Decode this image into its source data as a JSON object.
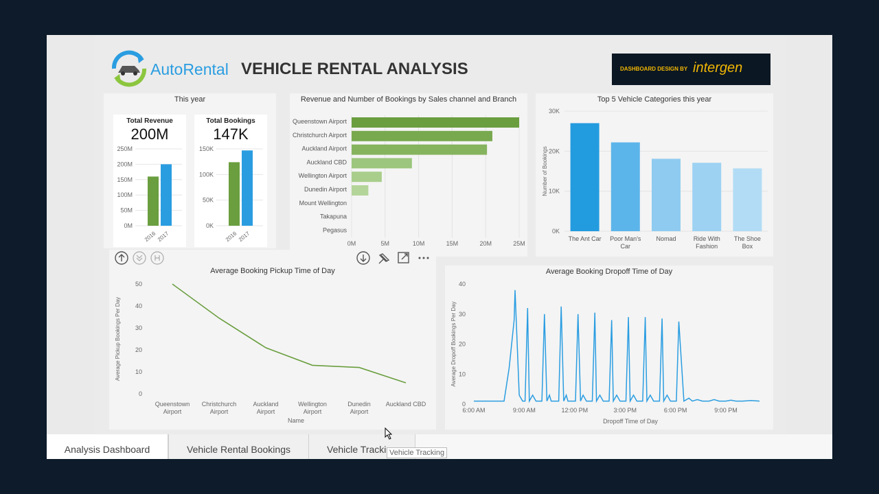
{
  "header": {
    "logo_text": "AutoRental",
    "title": "VEHICLE RENTAL ANALYSIS",
    "badge_prefix": "DASHBOARD DESIGN BY",
    "badge_brand": "intergen",
    "badge_colors": {
      "bg": "#0b1722",
      "prefix": "#f2b705",
      "brand": "#f2b705"
    }
  },
  "kpi_panel": {
    "title": "This year",
    "revenue": {
      "label": "Total Revenue",
      "value": "200M"
    },
    "bookings": {
      "label": "Total Bookings",
      "value": "147K"
    }
  },
  "toolbar": {
    "icons": [
      "arrow-up-circle-icon",
      "drill-down-icon",
      "expand-hierarchy-icon",
      "download-circle-icon",
      "pin-icon",
      "focus-mode-icon",
      "more-options-icon"
    ]
  },
  "tabs": [
    {
      "label": "Analysis Dashboard",
      "active": true
    },
    {
      "label": "Vehicle Rental Bookings",
      "active": false
    },
    {
      "label": "Vehicle Tracking",
      "active": false
    }
  ],
  "tooltip": {
    "text": "Vehicle Tracking"
  },
  "colors": {
    "green": "#6a9e3f",
    "blue": "#2a9de1",
    "light_blue": "#92cdf1",
    "line_green": "#6a9e3f",
    "line_blue": "#2a9de1"
  },
  "chart_data": [
    {
      "id": "revenue_mini",
      "type": "bar",
      "categories": [
        "2016",
        "2017"
      ],
      "values": [
        160,
        200
      ],
      "ylim": [
        0,
        250
      ],
      "yticks": [
        "0M",
        "50M",
        "100M",
        "150M",
        "200M",
        "250M"
      ],
      "colors": [
        "#6a9e3f",
        "#2a9de1"
      ]
    },
    {
      "id": "bookings_mini",
      "type": "bar",
      "categories": [
        "2016",
        "2017"
      ],
      "values": [
        124,
        147
      ],
      "ylim": [
        0,
        150
      ],
      "yticks": [
        "0K",
        "50K",
        "100K",
        "150K"
      ],
      "colors": [
        "#6a9e3f",
        "#2a9de1"
      ]
    },
    {
      "id": "channel_branch",
      "type": "bar",
      "orientation": "horizontal",
      "title": "Revenue and Number of Bookings by Sales channel and Branch",
      "categories": [
        "Queenstown Airport",
        "Christchurch Airport",
        "Auckland Airport",
        "Auckland CBD",
        "Wellington Airport",
        "Dunedin Airport",
        "Mount Wellington",
        "Takapuna",
        "Pegasus"
      ],
      "values": [
        25,
        21,
        20.2,
        9,
        4.5,
        2.5,
        0,
        0,
        0
      ],
      "xlim": [
        0,
        25
      ],
      "xticks": [
        "0M",
        "5M",
        "10M",
        "15M",
        "20M",
        "25M"
      ],
      "colors": [
        "#6a9e3f",
        "#78a94f",
        "#85b35e",
        "#9cc67d",
        "#a9ce8c",
        "#b4d59a",
        "#c5deb0",
        "#c5deb0",
        "#c5deb0"
      ]
    },
    {
      "id": "top5_categories",
      "type": "bar",
      "title": "Top 5 Vehicle Categories this year",
      "ylabel": "Number of Bookings",
      "categories": [
        "The Ant Car",
        "Poor Man's Car",
        "Nomad",
        "Ride With Fashion",
        "The Shoe Box"
      ],
      "category_lines": [
        [
          "The Ant Car"
        ],
        [
          "Poor Man's",
          "Car"
        ],
        [
          "Nomad"
        ],
        [
          "Ride With",
          "Fashion"
        ],
        [
          "The Shoe",
          "Box"
        ]
      ],
      "values": [
        27000,
        22200,
        18100,
        17100,
        15700
      ],
      "ylim": [
        0,
        30000
      ],
      "yticks": [
        "0K",
        "10K",
        "20K",
        "30K"
      ],
      "colors": [
        "#239bdf",
        "#5cb5ea",
        "#8fcbf0",
        "#9dd2f2",
        "#b2dcf5"
      ]
    },
    {
      "id": "pickup_time",
      "type": "line",
      "title": "Average Booking Pickup Time of Day",
      "xlabel": "Name",
      "ylabel": "Average Pickup Bookings Per Day",
      "categories": [
        "Queenstown Airport",
        "Christchurch Airport",
        "Auckland Airport",
        "Wellington Airport",
        "Dunedin Airport",
        "Auckland CBD"
      ],
      "category_lines": [
        [
          "Queenstown",
          "Airport"
        ],
        [
          "Christchurch",
          "Airport"
        ],
        [
          "Auckland",
          "Airport"
        ],
        [
          "Wellington",
          "Airport"
        ],
        [
          "Dunedin",
          "Airport"
        ],
        [
          "Auckland CBD"
        ]
      ],
      "values": [
        50,
        34.5,
        21,
        13,
        12,
        5
      ],
      "ylim": [
        0,
        50
      ],
      "yticks": [
        0,
        10,
        20,
        30,
        40,
        50
      ]
    },
    {
      "id": "dropoff_time",
      "type": "line",
      "title": "Average Booking Dropoff Time of Day",
      "xlabel": "Dropoff Time of Day",
      "ylabel": "Average Dropoff Bookings Per Day",
      "xticks": [
        "6:00 AM",
        "9:00 AM",
        "12:00 PM",
        "3:00 PM",
        "6:00 PM",
        "9:00 PM"
      ],
      "xlim": [
        6,
        23
      ],
      "ylim": [
        0,
        40
      ],
      "yticks": [
        0,
        10,
        20,
        30,
        40
      ],
      "x": [
        6.0,
        6.5,
        7.0,
        7.5,
        7.8,
        8.1,
        8.4,
        8.45,
        8.7,
        8.9,
        9.05,
        9.2,
        9.3,
        9.5,
        9.7,
        9.9,
        10.05,
        10.2,
        10.35,
        10.5,
        10.6,
        10.9,
        11.05,
        11.2,
        11.35,
        11.5,
        11.6,
        11.9,
        12.05,
        12.2,
        12.35,
        12.5,
        12.7,
        12.9,
        13.05,
        13.2,
        13.3,
        13.5,
        13.7,
        13.9,
        14.05,
        14.2,
        14.3,
        14.5,
        14.7,
        14.9,
        15.05,
        15.2,
        15.3,
        15.5,
        15.7,
        15.9,
        16.05,
        16.2,
        16.3,
        16.5,
        16.7,
        16.9,
        17.05,
        17.2,
        17.3,
        17.5,
        17.7,
        17.9,
        18.05,
        18.2,
        18.5,
        18.8,
        19.0,
        19.3,
        19.6,
        20.0,
        20.3,
        20.6,
        21.0,
        21.3,
        21.6,
        22.0,
        22.5,
        23.0
      ],
      "values": [
        1,
        1,
        1,
        1,
        1,
        12,
        28,
        38,
        3,
        1,
        1,
        32,
        1,
        3,
        1,
        1,
        1,
        30,
        1,
        3,
        1,
        1,
        1,
        32.5,
        1,
        3,
        1,
        1,
        1,
        30,
        1,
        3,
        1,
        1,
        1,
        30.5,
        1,
        3,
        1,
        1,
        1,
        28,
        1,
        3,
        1,
        1,
        1,
        29,
        1,
        3,
        1,
        1,
        1,
        29,
        1,
        3,
        1,
        1,
        1,
        28.5,
        1,
        3,
        1,
        1,
        1,
        27.5,
        1,
        2,
        1,
        1.5,
        1,
        1,
        1.5,
        1,
        1,
        1.3,
        1,
        1,
        1.2,
        1
      ]
    }
  ]
}
